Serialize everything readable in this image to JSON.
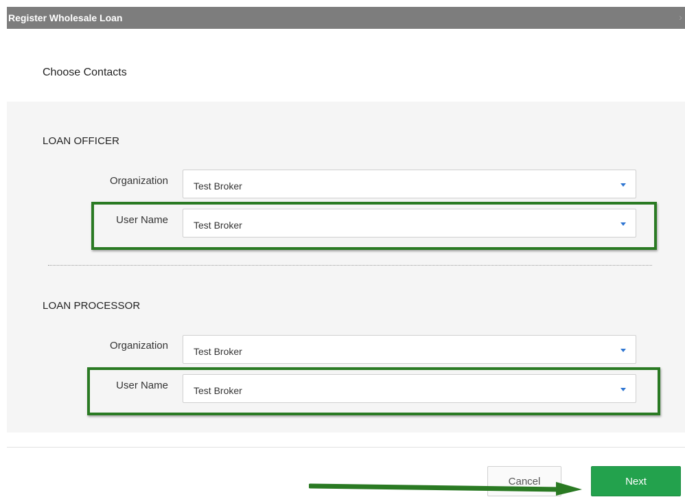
{
  "window": {
    "title": "Register Wholesale Loan",
    "close_glyph": "›"
  },
  "section_title": "Choose Contacts",
  "loan_officer": {
    "title": "LOAN OFFICER",
    "organization": {
      "label": "Organization",
      "value": "Test Broker"
    },
    "user_name": {
      "label": "User Name",
      "value": "Test Broker"
    }
  },
  "loan_processor": {
    "title": "LOAN PROCESSOR",
    "organization": {
      "label": "Organization",
      "value": "Test Broker"
    },
    "user_name": {
      "label": "User Name",
      "value": "Test Broker"
    }
  },
  "buttons": {
    "cancel": "Cancel",
    "next": "Next"
  },
  "colors": {
    "titlebar": "#7d7d7d",
    "highlight": "#2a7a23",
    "next_button": "#23a24d",
    "dropdown_chevron": "#2f76d2"
  }
}
